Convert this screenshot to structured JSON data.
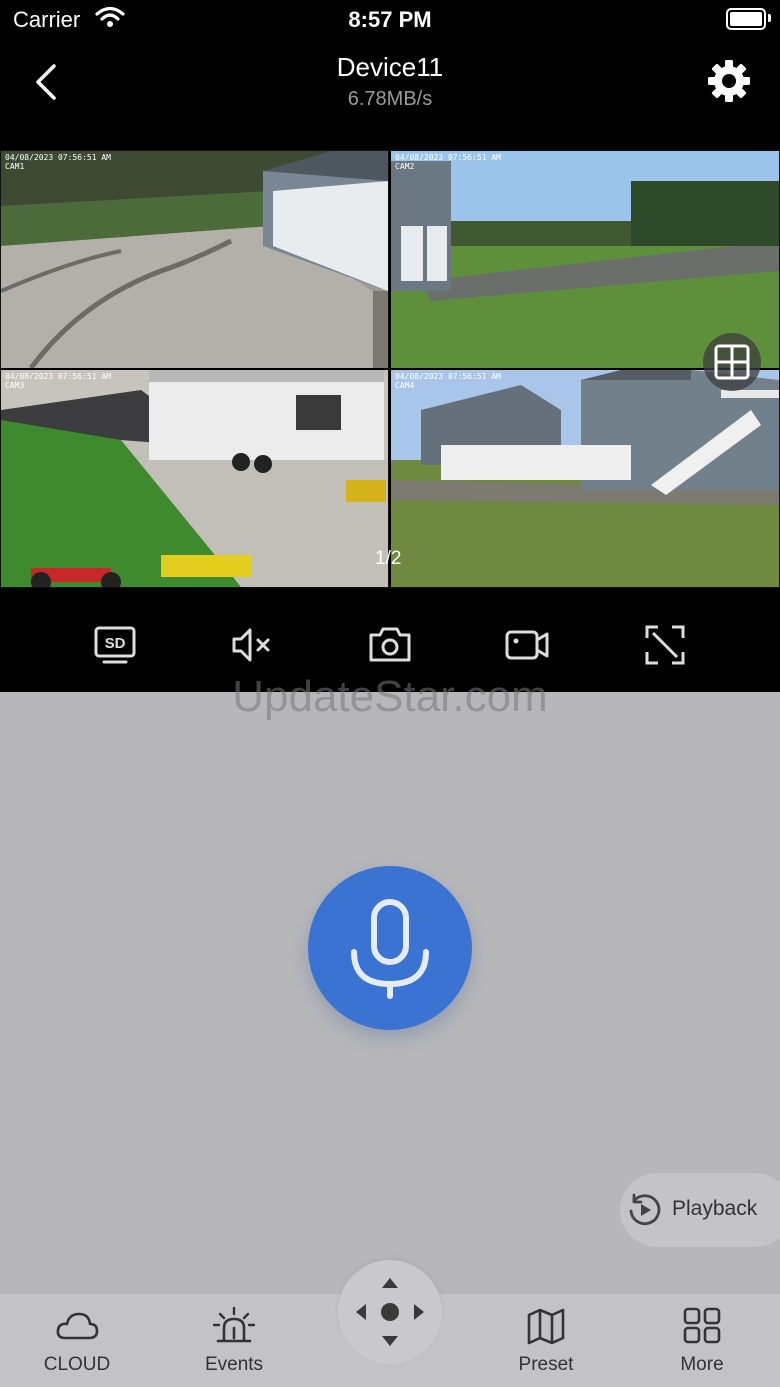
{
  "status_bar": {
    "carrier": "Carrier",
    "time": "8:57 PM"
  },
  "header": {
    "title": "Device11",
    "bitrate": "6.78MB/s"
  },
  "cameras": [
    {
      "timestamp": "04/08/2023 07:56:51 AM",
      "name": "CAM1"
    },
    {
      "timestamp": "04/08/2023 07:56:51 AM",
      "name": "CAM2"
    },
    {
      "timestamp": "04/08/2023 07:56:51 AM",
      "name": "CAM3"
    },
    {
      "timestamp": "04/08/2023 07:56:51 AM",
      "name": "CAM4"
    }
  ],
  "page_indicator": "1/2",
  "toolbar": {
    "sd_label": "SD"
  },
  "watermark": "UpdateStar.com",
  "playback": {
    "label": "Playback"
  },
  "tabs": [
    {
      "label": "CLOUD"
    },
    {
      "label": "Events"
    },
    {
      "label": "Preset"
    },
    {
      "label": "More"
    }
  ],
  "colors": {
    "accent": "#3b73d3",
    "panel_bg": "#b7b7b9",
    "top_bg": "#000000"
  }
}
